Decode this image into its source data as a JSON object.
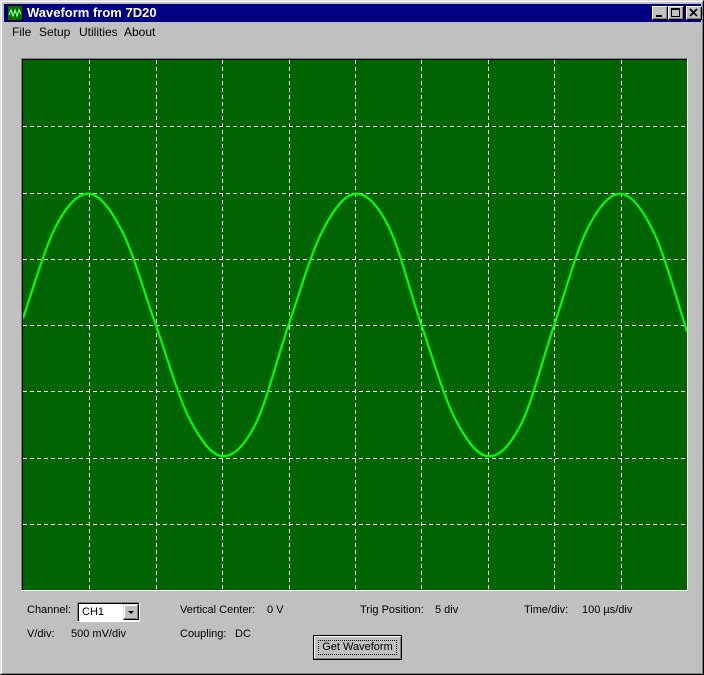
{
  "window": {
    "title": "Waveform from 7D20",
    "icon": "oscilloscope-icon",
    "controls": [
      "minimize-icon",
      "maximize-icon",
      "close-icon"
    ]
  },
  "menu": {
    "file": "File",
    "setup": "Setup",
    "utilities": "Utilities",
    "about": "About"
  },
  "scope": {
    "background_color": "#006400",
    "grid_color": "#ffffff",
    "trace_color": "#00ff00",
    "horizontal_divisions": 10,
    "vertical_divisions": 8,
    "grid_style": "dashed"
  },
  "chart_data": {
    "type": "line",
    "title": "",
    "xlabel": "",
    "ylabel": "",
    "x_unit_note": "",
    "xlim": [
      0,
      10
    ],
    "ylim": [
      -4,
      4
    ],
    "grid": true,
    "series": [
      {
        "x": [
          0,
          0.5,
          1.0,
          1.5,
          2.0,
          2.5,
          3.0,
          3.5,
          4.0,
          4.5,
          5.0,
          5.5,
          6.0,
          6.5,
          7.0,
          7.5,
          8.0,
          8.5,
          9.0,
          9.5,
          10.0
        ],
        "values": [
          0.1,
          1.5,
          1.98,
          1.4,
          0.0,
          -1.4,
          -1.98,
          -1.5,
          0.0,
          1.4,
          1.98,
          1.5,
          0.0,
          -1.4,
          -1.98,
          -1.5,
          0.0,
          1.45,
          1.98,
          1.4,
          -0.1
        ]
      }
    ]
  },
  "controls": {
    "channel_label": "Channel:",
    "channel_value": "CH1",
    "vdiv_label": "V/div:",
    "vdiv_value": "500 mV/div",
    "vcenter_label": "Vertical Center:",
    "vcenter_value": "0 V",
    "coupling_label": "Coupling:",
    "coupling_value": "DC",
    "trig_label": "Trig Position:",
    "trig_value": "5 div",
    "timediv_label": "Time/div:",
    "timediv_value": "100 µs/div",
    "get_waveform_label": "Get Waveform"
  }
}
